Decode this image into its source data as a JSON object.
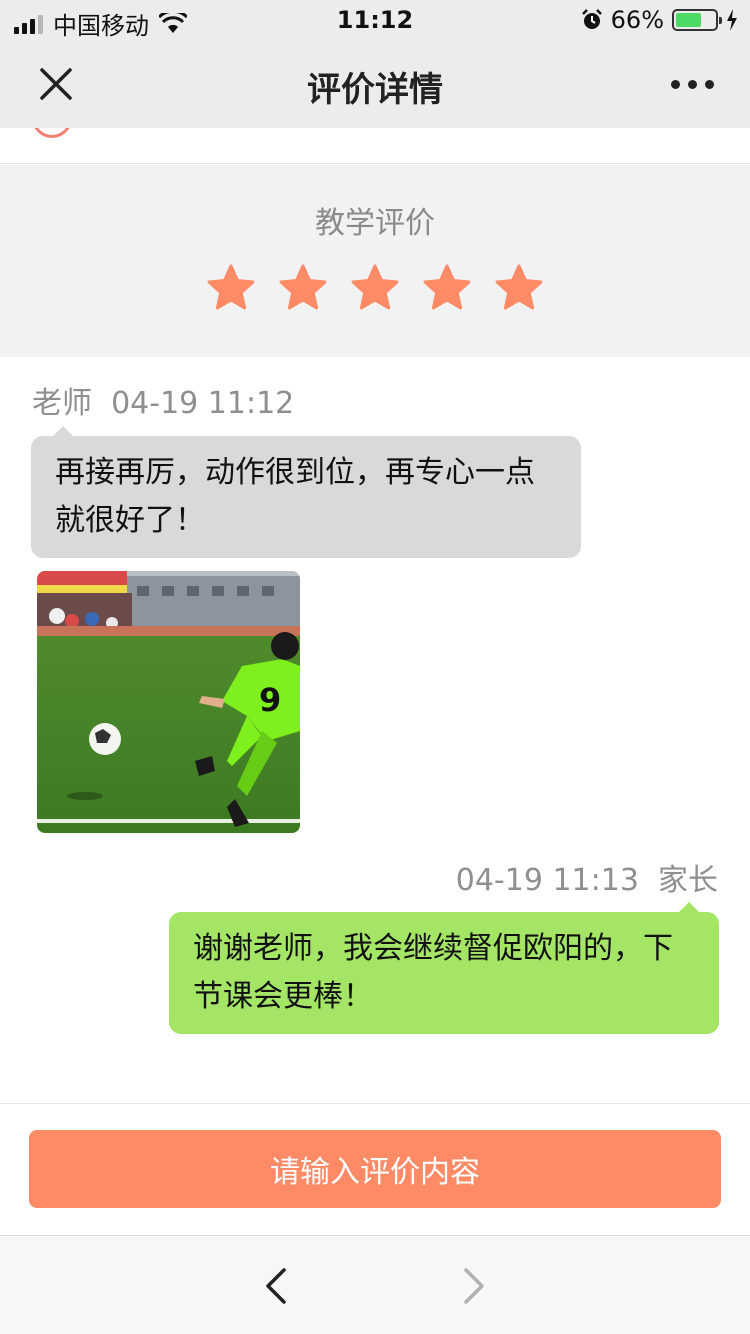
{
  "status_bar": {
    "carrier": "中国移动",
    "time": "11:12",
    "battery": "66%",
    "battery_level": 0.66
  },
  "nav": {
    "title": "评价详情",
    "close_icon": "close-icon",
    "more_icon": "more-icon"
  },
  "rating": {
    "title": "教学评价",
    "stars": 5,
    "max_stars": 5,
    "star_color": "#fe8b66"
  },
  "messages": [
    {
      "sender": "老师",
      "time": "04-19 11:12",
      "text": "再接再厉，动作很到位，再专心一点就很好了！",
      "bubble_color": "#d9d9d9"
    },
    {
      "sender": "家长",
      "time": "04-19 11:13",
      "text": "谢谢老师，我会继续督促欧阳的，下节课会更棒！",
      "bubble_color": "#a4e566"
    }
  ],
  "input": {
    "placeholder": "请输入评价内容",
    "color": "#fe8b66"
  },
  "toolbar": {
    "back_icon": "chevron-left-icon",
    "forward_icon": "chevron-right-icon"
  }
}
